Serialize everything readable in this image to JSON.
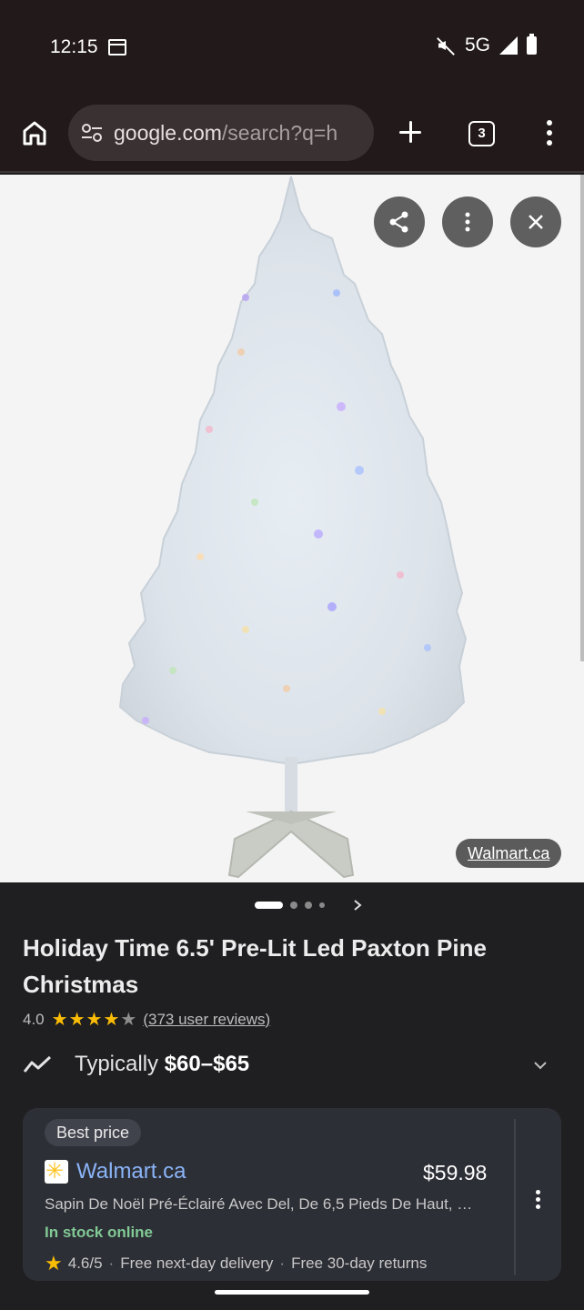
{
  "status_bar": {
    "time": "12:15",
    "network": "5G",
    "icons": [
      "calendar-icon",
      "mute-icon",
      "signal-icon",
      "battery-icon"
    ]
  },
  "browser": {
    "url_host": "google.com",
    "url_path": "/search?q=h",
    "tab_count": "3",
    "icons": [
      "home-icon",
      "tune-icon",
      "plus-icon",
      "kebab-menu-icon"
    ]
  },
  "viewer": {
    "source_label": "Walmart.ca",
    "actions": [
      "share-icon",
      "more-icon",
      "close-icon"
    ]
  },
  "carousel": {
    "total": 4,
    "active_index": 0
  },
  "product": {
    "title": "Holiday Time 6.5' Pre-Lit Led Paxton Pine Christmas",
    "rating_value": "4.0",
    "rating_stars": 4,
    "rating_max": 5,
    "reviews": "(373 user reviews)",
    "typically_prefix": "Typically ",
    "typical_range": "$60–$65"
  },
  "offer": {
    "badge": "Best price",
    "store": "Walmart.ca",
    "price": "$59.98",
    "description": "Sapin De Noël Pré-Éclairé Avec Del, De 6,5 Pieds De Haut, …",
    "stock": "In stock online",
    "store_rating": "4.6/5",
    "delivery": "Free next-day delivery",
    "returns": "Free 30-day returns"
  },
  "colors": {
    "accent_link": "#8ab4f8",
    "stock_green": "#81c995",
    "star_yellow": "#fbbc04"
  }
}
